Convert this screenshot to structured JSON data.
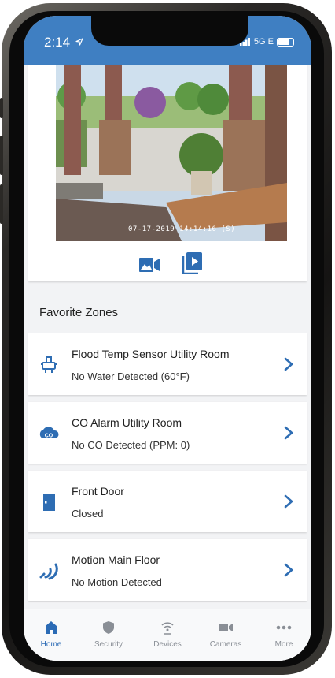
{
  "status": {
    "time": "2:14",
    "network": "5G E"
  },
  "camera": {
    "timestamp": "07-17-2019 14:14:16  (S)"
  },
  "favorites": {
    "title": "Favorite Zones",
    "items": [
      {
        "title": "Flood Temp Sensor Utility Room",
        "status": "No Water Detected (60°F)",
        "icon": "flood-sensor-icon"
      },
      {
        "title": "CO Alarm Utility Room",
        "status": "No CO Detected (PPM: 0)",
        "icon": "co-alarm-icon"
      },
      {
        "title": "Front Door",
        "status": "Closed",
        "icon": "door-icon"
      },
      {
        "title": "Motion Main Floor",
        "status": "No Motion Detected",
        "icon": "motion-sensor-icon"
      }
    ]
  },
  "tabs": [
    {
      "label": "Home",
      "icon": "home-icon",
      "active": true
    },
    {
      "label": "Security",
      "icon": "shield-icon"
    },
    {
      "label": "Devices",
      "icon": "wifi-icon"
    },
    {
      "label": "Cameras",
      "icon": "camera-icon"
    },
    {
      "label": "More",
      "icon": "more-icon"
    }
  ],
  "colors": {
    "accent": "#3f7fc2",
    "active_tab": "#2b6bb5",
    "icon_blue": "#2e6db3"
  }
}
